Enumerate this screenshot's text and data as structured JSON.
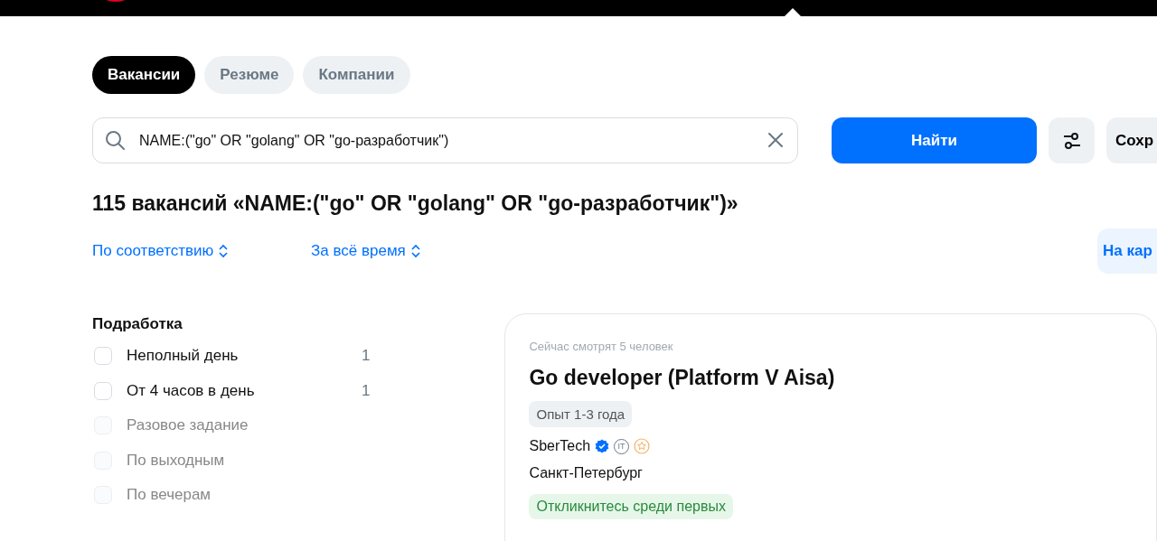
{
  "tabs": [
    {
      "label": "Вакансии",
      "selected": true
    },
    {
      "label": "Резюме",
      "selected": false
    },
    {
      "label": "Компании",
      "selected": false
    }
  ],
  "search": {
    "value": "NAME:(\"go\" OR \"golang\" OR \"go-разработчик\")"
  },
  "search_button": "Найти",
  "save_button": "Сохр",
  "results_heading": "115 вакансий «NAME:(\"go\" OR \"golang\" OR \"go-разработчик\")»",
  "sort_options": [
    {
      "label": "По соответствию"
    },
    {
      "label": "За всё время"
    }
  ],
  "map_button": "На кар",
  "filter_group": {
    "title": "Подработка",
    "options": [
      {
        "label": "Неполный день",
        "count": "1",
        "checked": false,
        "disabled": false
      },
      {
        "label": "От 4 часов в день",
        "count": "1",
        "checked": false,
        "disabled": false
      },
      {
        "label": "Разовое задание",
        "checked": false,
        "disabled": true
      },
      {
        "label": "По выходным",
        "checked": false,
        "disabled": true
      },
      {
        "label": "По вечерам",
        "checked": false,
        "disabled": true
      }
    ]
  },
  "vacancy": {
    "viewers": "Сейчас смотрят 5 человек",
    "title": "Go developer (Platform V Aisa)",
    "experience": "Опыт 1-3 года",
    "company": "SberTech",
    "it_badge": "IT",
    "city": "Санкт-Петербург",
    "highlight": "Откликнитесь среди первых"
  }
}
